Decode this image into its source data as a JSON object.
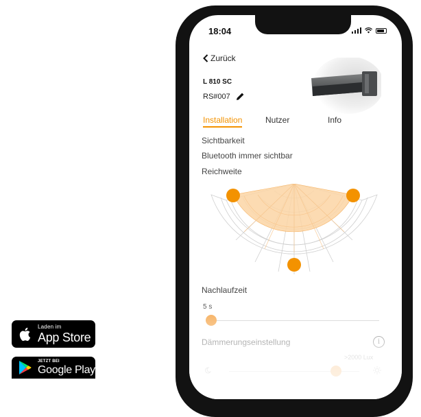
{
  "store_badges": {
    "apple": {
      "small": "Laden im",
      "big": "App Store",
      "icon": "apple-icon"
    },
    "google": {
      "small": "JETZT BEI",
      "big": "Google Play",
      "icon": "google-play-icon"
    }
  },
  "status_bar": {
    "time": "18:04"
  },
  "nav": {
    "back_label": "Zurück"
  },
  "device": {
    "model": "L 810 SC",
    "serial": "RS#007"
  },
  "tabs": [
    {
      "label": "Installation",
      "active": true
    },
    {
      "label": "Nutzer",
      "active": false
    },
    {
      "label": "Info",
      "active": false
    }
  ],
  "settings": {
    "visibility_heading": "Sichtbarkeit",
    "bluetooth_label": "Bluetooth immer sichtbar",
    "range_heading": "Reichweite",
    "follow_up_heading": "Nachlaufzeit",
    "follow_up_value": "5 s",
    "follow_up_fraction": 0.0,
    "twilight_heading": "Dämmerungseinstellung",
    "twilight_max_label": ">2000 Lux",
    "twilight_fraction": 0.85
  },
  "colors": {
    "accent": "#f39200",
    "range_fill": "#fbd5a5",
    "handle": "#f39200"
  }
}
